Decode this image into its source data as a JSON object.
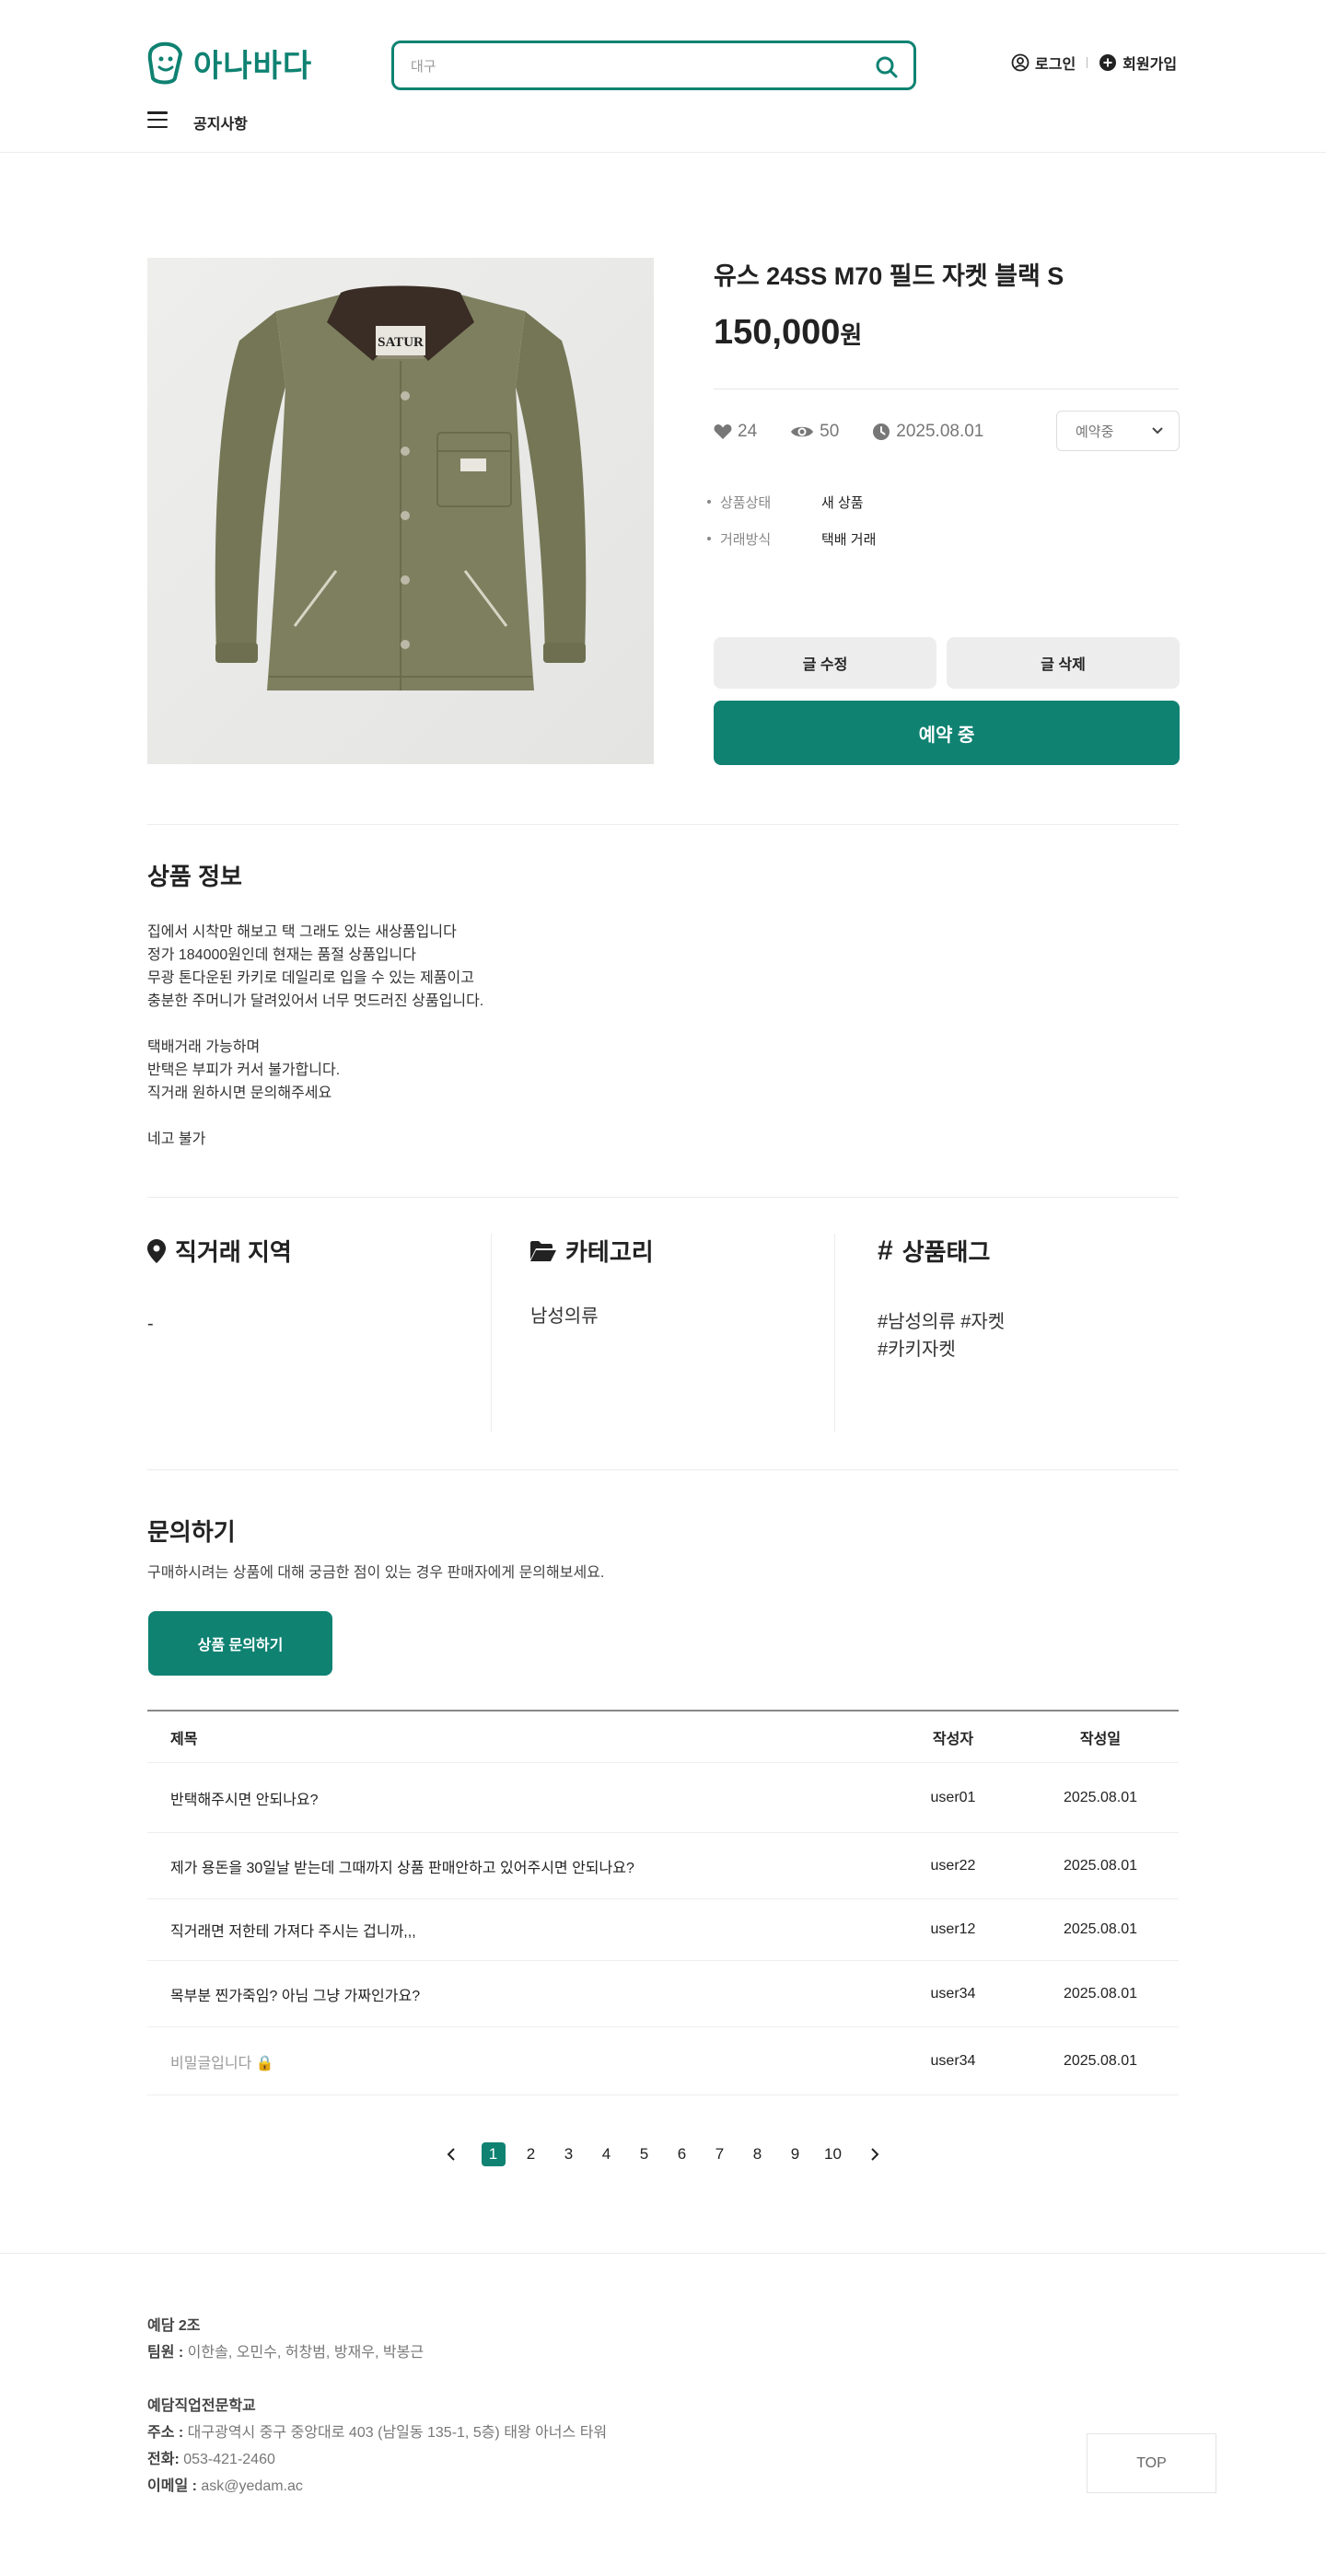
{
  "header": {
    "logo_text": "아나바다",
    "search_placeholder": "대구",
    "login_label": "로그인",
    "signup_label": "회원가입",
    "nav_notice": "공지사항"
  },
  "product": {
    "title": "유스 24SS M70 필드 자켓 블랙 S",
    "price": "150,000",
    "price_unit": "원",
    "likes": "24",
    "views": "50",
    "date": "2025.08.01",
    "status_select": "예약중",
    "collar_label": "SATUR",
    "info": [
      {
        "key": "상품상태",
        "value": "새 상품"
      },
      {
        "key": "거래방식",
        "value": "택배 거래"
      }
    ],
    "edit_label": "글 수정",
    "delete_label": "글 삭제",
    "reserved_label": "예약 중"
  },
  "description": {
    "title": "상품 정보",
    "lines": [
      "집에서 시착만 해보고 택 그래도 있는 새상품입니다",
      "정가 184000원인데 현재는 품절 상품입니다",
      "무광 톤다운된 카키로 데일리로 입을 수 있는 제품이고",
      "충분한 주머니가 달려있어서 너무 멋드러진 상품입니다.",
      "",
      "택배거래 가능하며",
      "반택은 부피가 커서 불가합니다.",
      "직거래 원하시면 문의해주세요",
      "",
      "네고 불가"
    ]
  },
  "details": {
    "region_title": "직거래 지역",
    "region_value": "-",
    "category_title": "카테고리",
    "category_value": "남성의류",
    "tag_title": "상품태그",
    "tags_line1": "#남성의류 #자켓",
    "tags_line2": "#카키자켓"
  },
  "inquiry": {
    "title": "문의하기",
    "desc": "구매하시려는 상품에 대해 궁금한 점이 있는 경우 판매자에게 문의해보세요.",
    "button_label": "상품 문의하기",
    "columns": [
      "제목",
      "작성자",
      "작성일"
    ],
    "rows": [
      {
        "title": "반택해주시면 안되나요?",
        "author": "user01",
        "date": "2025.08.01"
      },
      {
        "title": "제가 용돈을 30일날 받는데 그때까지 상품 판매안하고 있어주시면 안되나요?",
        "author": "user22",
        "date": "2025.08.01"
      },
      {
        "title": "직거래면 저한테 가져다 주시는 겁니까,,,",
        "author": "user12",
        "date": "2025.08.01"
      },
      {
        "title": "목부분 찐가죽임? 아님 그냥 가짜인가요?",
        "author": "user34",
        "date": "2025.08.01"
      },
      {
        "title": "비밀글입니다 🔒",
        "author": "user34",
        "date": "2025.08.01"
      }
    ]
  },
  "pagination": {
    "pages": [
      "1",
      "2",
      "3",
      "4",
      "5",
      "6",
      "7",
      "8",
      "9",
      "10"
    ],
    "current": "1"
  },
  "footer": {
    "team_name": "예담 2조",
    "team_label": "팀원 :",
    "team_members": "이한솔, 오민수, 허창범, 방재우, 박봉근",
    "school": "예담직업전문학교",
    "address_label": "주소 :",
    "address": "대구광역시 중구 중앙대로 403 (남일동 135-1, 5층) 태왕 아너스 타워",
    "phone_label": "전화:",
    "phone": "053-421-2460",
    "email_label": "이메일 :",
    "email": "ask@yedam.ac",
    "top_label": "TOP"
  },
  "colors": {
    "accent": "#0f8272",
    "jacket": "#7d7f5f",
    "collar": "#3a2d25"
  }
}
